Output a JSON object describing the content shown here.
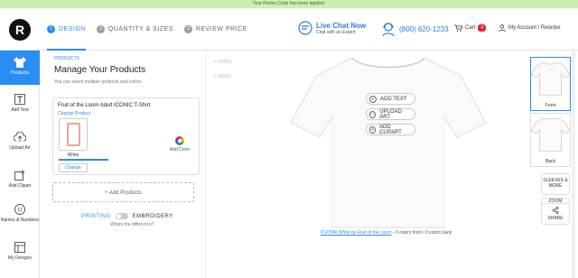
{
  "promo": {
    "text": "Your Promo Code has been applied."
  },
  "header": {
    "logo_letter": "R",
    "steps": [
      {
        "num": "1",
        "label": "DESIGN"
      },
      {
        "num": "2",
        "label": "QUANTITY & SIZES"
      },
      {
        "num": "3",
        "label": "REVIEW PRICE"
      }
    ],
    "chat": {
      "title": "Live Chat Now",
      "subtitle": "Chat with an Expert"
    },
    "phone": "(800) 620-1233",
    "cart": {
      "label": "Cart",
      "count": "4"
    },
    "account": "My Account / Reorder"
  },
  "leftnav": {
    "items": [
      {
        "label": "Products",
        "icon": "tshirt-icon"
      },
      {
        "label": "Add Text",
        "icon": "text-icon"
      },
      {
        "label": "Upload Art",
        "icon": "upload-icon"
      },
      {
        "label": "Add Clipart",
        "icon": "clipart-icon"
      },
      {
        "label": "Names & Numbers",
        "icon": "numbers-icon"
      },
      {
        "label": "My Designs",
        "icon": "designs-icon"
      }
    ]
  },
  "panel": {
    "tag": "PRODUCTS",
    "title": "Manage Your Products",
    "subtitle": "You can select multiple products and colors.",
    "product_name": "Fruit of the Loom Adult ICONIC T-Shirt",
    "change_product": "Change Product",
    "color_label": "White",
    "change_btn": "Change",
    "add_color": "Add Color",
    "add_products": "+ Add Products",
    "printing": "PRINTING",
    "embroidery": "EMBROIDERY",
    "whats_difference": "Whats the difference?"
  },
  "canvas": {
    "undo": "UNDO",
    "redo": "REDO",
    "add_text": "ADD TEXT",
    "upload_art": "UPLOAD ART",
    "add_clipart": "ADD CLIPART",
    "caption_link": "IC47MR White by Fruit of the Loom",
    "caption_rest": " - 0 colors front  /  0 colors back"
  },
  "views": {
    "front": "Front",
    "back": "Back",
    "sleeves": "SLEEVES & MORE",
    "zoom": "ZOOM",
    "share": "SHARE"
  },
  "colors": {
    "accent": "#2a8df5",
    "promo_bg": "#c9efb4",
    "badge": "#e0262b"
  }
}
